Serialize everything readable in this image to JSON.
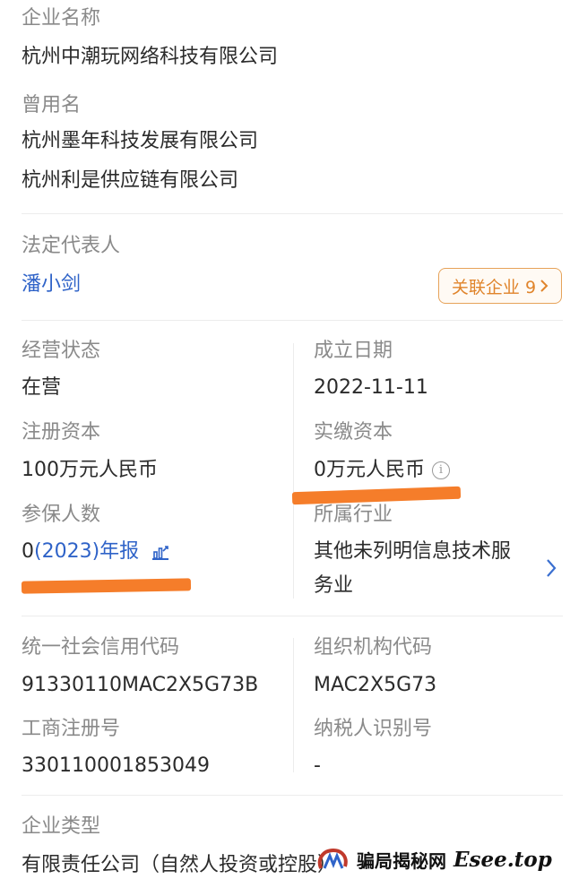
{
  "company_name": {
    "label": "企业名称",
    "value": "杭州中潮玩网络科技有限公司"
  },
  "former_names": {
    "label": "曾用名",
    "items": [
      "杭州墨年科技发展有限公司",
      "杭州利是供应链有限公司"
    ]
  },
  "legal_rep": {
    "label": "法定代表人",
    "name": "潘小剑",
    "related_button": "关联企业 9"
  },
  "business_status": {
    "label": "经营状态",
    "value": "在营"
  },
  "founded_date": {
    "label": "成立日期",
    "value": "2022-11-11"
  },
  "registered_capital": {
    "label": "注册资本",
    "value": "100万元人民币"
  },
  "paid_capital": {
    "label": "实缴资本",
    "value": "0万元人民币"
  },
  "insured_count": {
    "label": "参保人数",
    "value": "0",
    "report_link": "(2023)年报"
  },
  "industry": {
    "label": "所属行业",
    "line1": "其他未列明信息技术服",
    "line2": "务业"
  },
  "credit_code": {
    "label": "统一社会信用代码",
    "value": "91330110MAC2X5G73B"
  },
  "org_code": {
    "label": "组织机构代码",
    "value": "MAC2X5G73"
  },
  "business_reg_no": {
    "label": "工商注册号",
    "value": "330110001853049"
  },
  "taxpayer_id": {
    "label": "纳税人识别号",
    "value": "-"
  },
  "company_type": {
    "label": "企业类型",
    "value": "有限责任公司（自然人投资或控股）"
  },
  "watermark": {
    "site_name": "骗局揭秘网",
    "domain": "Esee.top"
  },
  "colors": {
    "link": "#2f63c8",
    "accent_orange": "#f57d2a",
    "button_border": "#e6a35a"
  },
  "icons": [
    "info-icon",
    "chart-icon",
    "chevron-right-icon",
    "arrow-right-icon"
  ]
}
